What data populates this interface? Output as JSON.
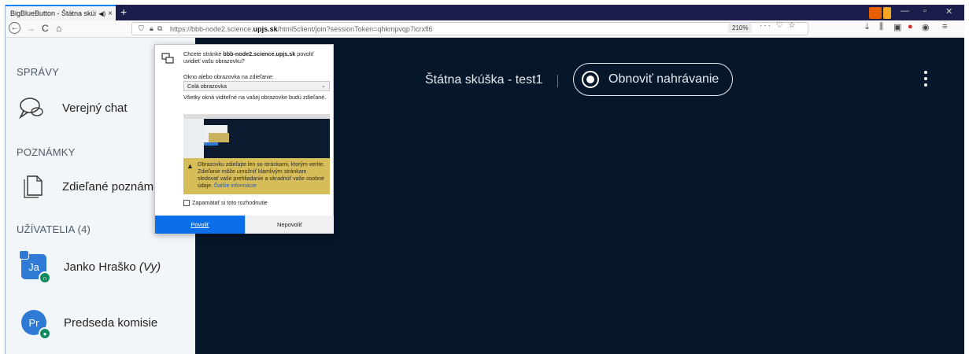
{
  "tab": {
    "title": "BigBlueButton - Štátna skúška",
    "audio_icon": "speaker-icon",
    "close": "×",
    "new": "+"
  },
  "nav": {
    "back": "←",
    "forward": "→",
    "reload": "C",
    "home": "⌂",
    "url_prefix": "https://bbb-node2.science.",
    "url_domain": "upjs.sk",
    "url_suffix": "/html5client/join?sessionToken=qhkmpvqp7icrxfl6",
    "zoom": "210%",
    "url_icons": "··· ♡ ☆",
    "toolbar_icons": [
      "⤓",
      "⫼",
      "▣",
      "●",
      "◉",
      "≡"
    ]
  },
  "sidebar": {
    "messages_title": "SPRÁVY",
    "public_chat": "Verejný chat",
    "notes_title": "POZNÁMKY",
    "shared_notes": "Zdieľané poznámky",
    "users_title": "UŽÍVATELIA (4)",
    "users": [
      {
        "initials": "Ja",
        "name": "Janko Hraško",
        "suffix": "(Vy)"
      },
      {
        "initials": "Pr",
        "name": "Predseda komisie",
        "suffix": ""
      }
    ]
  },
  "main": {
    "title": "Štátna skúška - test1",
    "record_label": "Obnoviť nahrávanie"
  },
  "popup": {
    "question_pre": "Chcete stránke ",
    "question_site": "bbb-node2.science.upjs.sk",
    "question_post": " povoliť uvidieť vašu obrazovku?",
    "select_label": "Okno alebo obrazovka na zdieľanie:",
    "select_value": "Celá obrazovka",
    "note": "Všetky okná viditeľné na vašej obrazovke budú zdieľané.",
    "warning": "Obrazovku zdieľajte len so stránkami, ktorým veríte. Zdieľanie môže umožniť klamlivým stránkam sledovať vaše prehliadanie a ukradnúť vaše osobné údaje. ",
    "warning_link": "Ďalšie informácie",
    "remember": "Zapamätať si toto rozhodnutie",
    "allow": "Povoliť",
    "deny": "Nepovoliť"
  }
}
